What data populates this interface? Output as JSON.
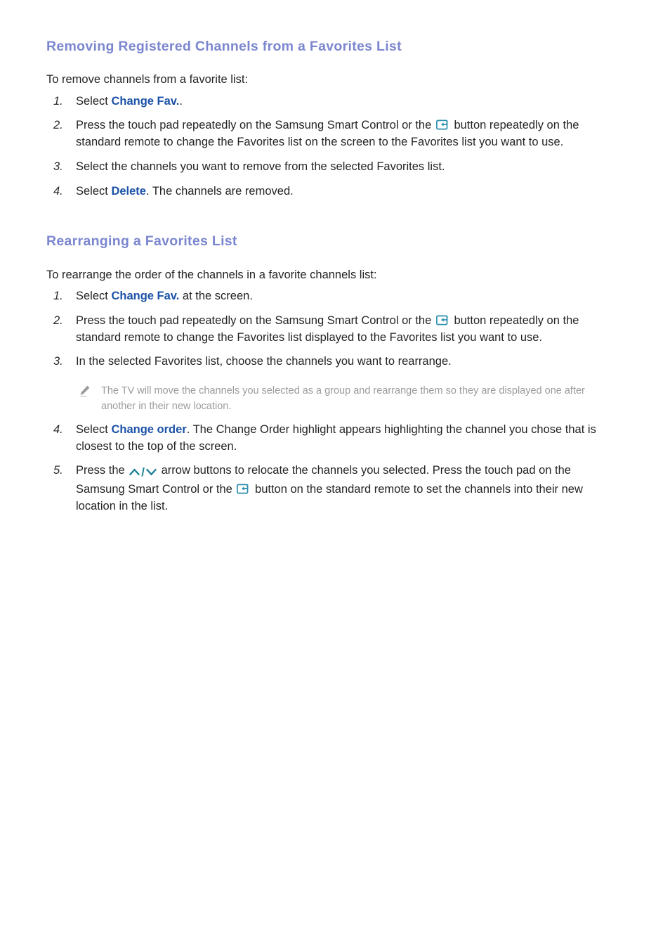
{
  "document": {
    "page_background": "#ffffff",
    "heading_color": "#7b86cf",
    "link_color": "#1c52a8",
    "body_color": "#242424",
    "note_color": "#9b9b9b",
    "icon_color": "#1a7f96"
  },
  "sections": [
    {
      "heading": "Removing Registered Channels from a Favorites List",
      "intro": "To remove channels from a favorite list:",
      "steps": [
        {
          "num": "1.",
          "parts": [
            {
              "type": "text",
              "text": "Select "
            },
            {
              "type": "term",
              "text": "Change Fav."
            },
            {
              "type": "text",
              "text": "."
            }
          ]
        },
        {
          "num": "2.",
          "parts": [
            {
              "type": "text",
              "text": "Press the touch pad repeatedly on the Samsung Smart Control or the "
            },
            {
              "type": "icon",
              "icon": "enter-button-icon"
            },
            {
              "type": "text",
              "text": " button repeatedly on the standard remote to change the Favorites list on the screen to the Favorites list you want to use."
            }
          ]
        },
        {
          "num": "3.",
          "parts": [
            {
              "type": "text",
              "text": "Select the channels you want to remove from the selected Favorites list."
            }
          ]
        },
        {
          "num": "4.",
          "parts": [
            {
              "type": "text",
              "text": "Select "
            },
            {
              "type": "term",
              "text": "Delete"
            },
            {
              "type": "text",
              "text": ". The channels are removed."
            }
          ]
        }
      ]
    },
    {
      "heading": "Rearranging a Favorites List",
      "intro": "To rearrange the order of the channels in a favorite channels list:",
      "steps": [
        {
          "num": "1.",
          "parts": [
            {
              "type": "text",
              "text": "Select "
            },
            {
              "type": "term",
              "text": "Change Fav."
            },
            {
              "type": "text",
              "text": " at the screen."
            }
          ]
        },
        {
          "num": "2.",
          "parts": [
            {
              "type": "text",
              "text": "Press the touch pad repeatedly on the Samsung Smart Control or the "
            },
            {
              "type": "icon",
              "icon": "enter-button-icon"
            },
            {
              "type": "text",
              "text": " button repeatedly on the standard remote to change the Favorites list displayed to the Favorites list you want to use."
            }
          ]
        },
        {
          "num": "3.",
          "parts": [
            {
              "type": "text",
              "text": "In the selected Favorites list, choose the channels you want to rearrange."
            }
          ],
          "note": {
            "icon": "pencil-note-icon",
            "text": "The TV will move the channels you selected as a group and rearrange them so they are displayed one after another in their new location."
          }
        },
        {
          "num": "4.",
          "parts": [
            {
              "type": "text",
              "text": "Select "
            },
            {
              "type": "term",
              "text": "Change order"
            },
            {
              "type": "text",
              "text": ". The Change Order highlight appears highlighting the channel you chose that is closest to the top of the screen."
            }
          ]
        },
        {
          "num": "5.",
          "parts": [
            {
              "type": "text",
              "text": "Press the "
            },
            {
              "type": "icon",
              "icon": "up-down-arrow-icons"
            },
            {
              "type": "text",
              "text": " arrow buttons to relocate the channels you selected. Press the touch pad on the Samsung Smart Control or the "
            },
            {
              "type": "icon",
              "icon": "enter-button-icon"
            },
            {
              "type": "text",
              "text": " button on the standard remote to set the channels into their new location in the list."
            }
          ]
        }
      ]
    }
  ]
}
